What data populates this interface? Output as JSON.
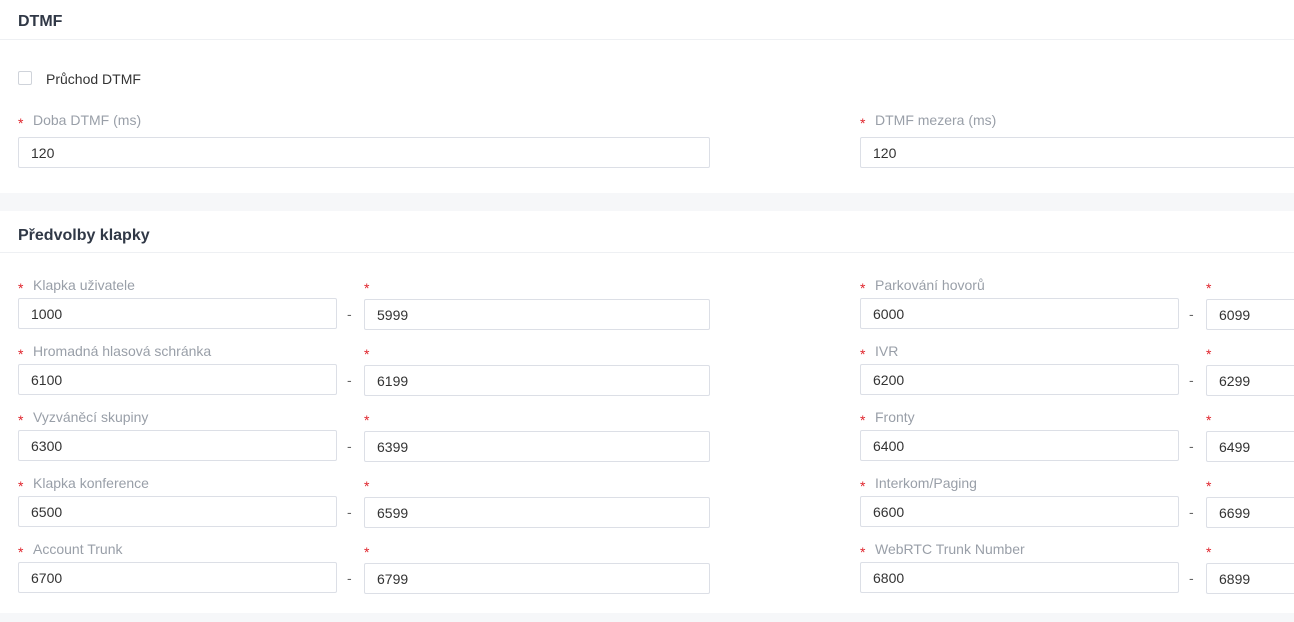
{
  "dtmf": {
    "title": "DTMF",
    "passthrough_label": "Průchod DTMF",
    "passthrough_checked": false,
    "duration": {
      "label": "Doba DTMF (ms)",
      "value": "120"
    },
    "gap": {
      "label": "DTMF mezera (ms)",
      "value": "120"
    }
  },
  "ext": {
    "title": "Předvolby klapky",
    "required_mark": "*",
    "separator": "-",
    "rows": [
      {
        "left": {
          "label": "Klapka uživatele",
          "from": "1000",
          "to": "5999"
        },
        "right": {
          "label": "Parkování hovorů",
          "from": "6000",
          "to": "6099"
        }
      },
      {
        "left": {
          "label": "Hromadná hlasová schránka",
          "from": "6100",
          "to": "6199"
        },
        "right": {
          "label": "IVR",
          "from": "6200",
          "to": "6299"
        }
      },
      {
        "left": {
          "label": "Vyzváněcí skupiny",
          "from": "6300",
          "to": "6399"
        },
        "right": {
          "label": "Fronty",
          "from": "6400",
          "to": "6499"
        }
      },
      {
        "left": {
          "label": "Klapka konference",
          "from": "6500",
          "to": "6599"
        },
        "right": {
          "label": "Interkom/Paging",
          "from": "6600",
          "to": "6699"
        }
      },
      {
        "left": {
          "label": "Account Trunk",
          "from": "6700",
          "to": "6799"
        },
        "right": {
          "label": "WebRTC Trunk Number",
          "from": "6800",
          "to": "6899"
        }
      }
    ]
  },
  "colors": {
    "background": "#f6f7f9",
    "panel": "#ffffff",
    "required": "#e0242c",
    "label": "#999fa8",
    "border": "#dcdfe6"
  }
}
